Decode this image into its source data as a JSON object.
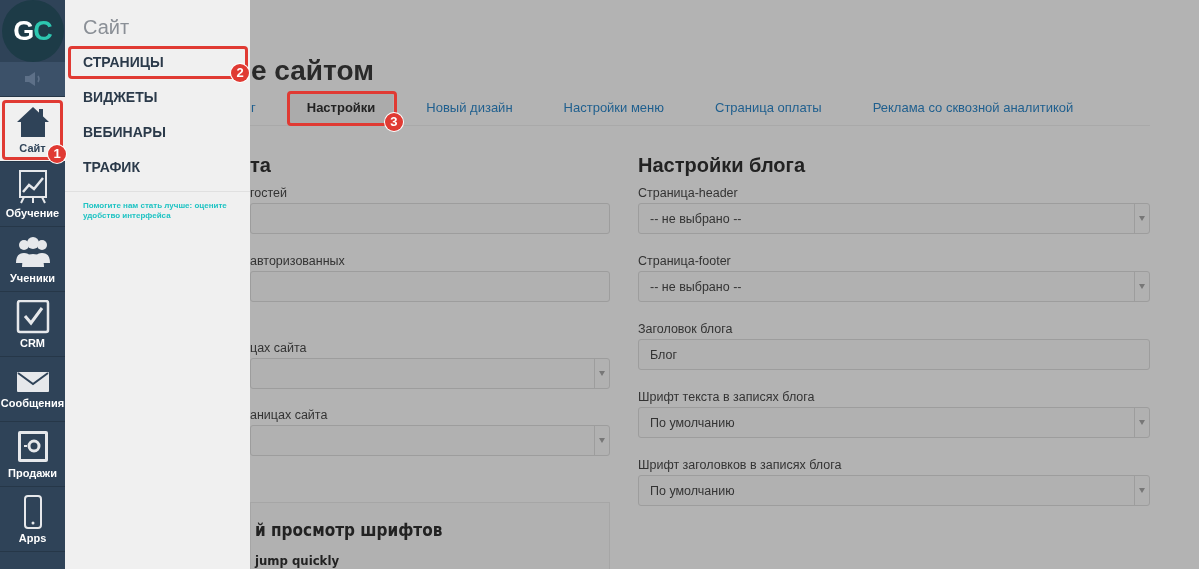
{
  "logo": {
    "letters": [
      "G",
      "C"
    ]
  },
  "nav": [
    {
      "kind": "sound",
      "selected": false
    },
    {
      "kind": "house",
      "label": "Сайт",
      "selected": true,
      "callout": "1"
    },
    {
      "kind": "chart",
      "label": "Обучение",
      "selected": false
    },
    {
      "kind": "people",
      "label": "Ученики",
      "selected": false
    },
    {
      "kind": "check",
      "label": "CRM",
      "selected": false
    },
    {
      "kind": "mail",
      "label": "Сообщения",
      "selected": false
    },
    {
      "kind": "safe",
      "label": "Продажи",
      "selected": false
    },
    {
      "kind": "phone",
      "label": "Apps",
      "selected": false
    }
  ],
  "flyout": {
    "title": "Сайт",
    "items": [
      {
        "label": "СТРАНИЦЫ",
        "callout": "2"
      },
      {
        "label": "ВИДЖЕТЫ"
      },
      {
        "label": "ВЕБИНАРЫ"
      },
      {
        "label": "ТРАФИК"
      }
    ],
    "feedback_link": "Помогите нам стать лучше: оцените удобство интерфейса"
  },
  "page_title": "е сайтом",
  "tabs": [
    {
      "label": "г",
      "selected": false
    },
    {
      "label": "Настройки",
      "selected": true,
      "callout": "3"
    },
    {
      "label": "Новый дизайн",
      "selected": false
    },
    {
      "label": "Настройки меню",
      "selected": false
    },
    {
      "label": "Страница оплаты",
      "selected": false
    },
    {
      "label": "Реклама со сквозной аналитикой",
      "selected": false
    }
  ],
  "left_section": {
    "heading": "та",
    "fields": [
      {
        "label": "гостей",
        "kind": "text"
      },
      {
        "label": "авторизованных",
        "kind": "text"
      },
      {
        "label": "цах сайта",
        "kind": "select"
      },
      {
        "label": "аницах сайта",
        "kind": "select"
      }
    ],
    "font_preview": {
      "heading": "й просмотр шрифтов",
      "sample": "jump quickly"
    }
  },
  "right_section": {
    "heading": "Настройки блога",
    "fields": [
      {
        "label": "Страница-header",
        "kind": "select",
        "value": "-- не выбрано --"
      },
      {
        "label": "Страница-footer",
        "kind": "select",
        "value": "-- не выбрано --"
      },
      {
        "label": "Заголовок блога",
        "kind": "text",
        "value": "Блог"
      },
      {
        "label": "Шрифт текста в записях блога",
        "kind": "select",
        "value": "По умолчанию"
      },
      {
        "label": "Шрифт заголовков в записях блога",
        "kind": "select",
        "value": "По умолчанию"
      }
    ]
  }
}
